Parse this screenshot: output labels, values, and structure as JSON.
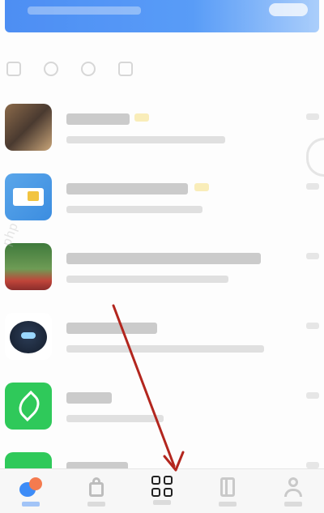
{
  "banner": {
    "color": "#3d8cf7"
  },
  "quick_icons": [
    "scan-icon",
    "search-icon",
    "contacts-icon",
    "calendar-icon"
  ],
  "chats": [
    {
      "name": "chat-1",
      "avatar_style": "photo-dark"
    },
    {
      "name": "chat-2",
      "avatar_style": "blue-card"
    },
    {
      "name": "chat-3",
      "avatar_style": "green-red-photo"
    },
    {
      "name": "chat-4",
      "avatar_style": "dark-robot"
    },
    {
      "name": "chat-5",
      "avatar_style": "green-leaf"
    },
    {
      "name": "chat-6",
      "avatar_style": "green"
    }
  ],
  "bottom_nav": {
    "items": [
      {
        "icon": "messages-icon",
        "active": true
      },
      {
        "icon": "bag-icon",
        "active": false
      },
      {
        "icon": "workbench-grid-icon",
        "active": false,
        "highlighted": true
      },
      {
        "icon": "document-icon",
        "active": false
      },
      {
        "icon": "user-icon",
        "active": false
      }
    ]
  },
  "watermark": "php",
  "colors": {
    "accent": "#3d8cf7",
    "badge": "#f47b4f",
    "arrow": "#b3261e",
    "online_green": "#2fc95a"
  }
}
